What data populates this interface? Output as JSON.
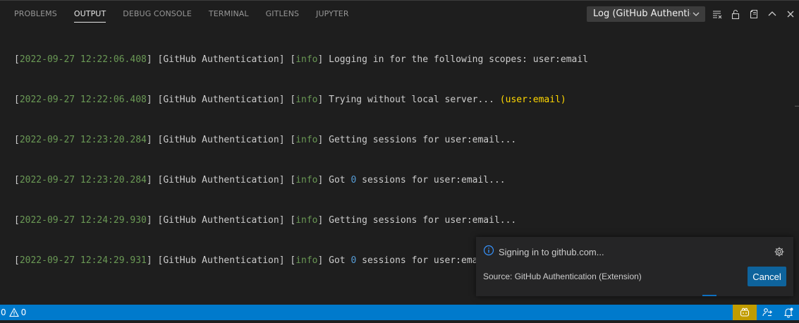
{
  "tabs": [
    {
      "label": "PROBLEMS",
      "active": false
    },
    {
      "label": "OUTPUT",
      "active": true
    },
    {
      "label": "DEBUG CONSOLE",
      "active": false
    },
    {
      "label": "TERMINAL",
      "active": false
    },
    {
      "label": "GITLENS",
      "active": false
    },
    {
      "label": "JUPYTER",
      "active": false
    }
  ],
  "output_channel": {
    "selected": "Log (GitHub Authentication)"
  },
  "actions": [
    "clear-output-icon",
    "lock-scroll-icon",
    "open-in-editor-icon",
    "maximize-panel-icon",
    "close-panel-icon"
  ],
  "log": [
    {
      "ts": "2022-09-27 12:22:06.408",
      "source": "GitHub Authentication",
      "level": "info",
      "pre": "Logging in for the following scopes: user:email",
      "num": "",
      "paren": "",
      "post": ""
    },
    {
      "ts": "2022-09-27 12:22:06.408",
      "source": "GitHub Authentication",
      "level": "info",
      "pre": "Trying without local server... ",
      "num": "",
      "paren": "(user:email)",
      "post": ""
    },
    {
      "ts": "2022-09-27 12:23:20.284",
      "source": "GitHub Authentication",
      "level": "info",
      "pre": "Getting sessions for user:email...",
      "num": "",
      "paren": "",
      "post": ""
    },
    {
      "ts": "2022-09-27 12:23:20.284",
      "source": "GitHub Authentication",
      "level": "info",
      "pre": "Got ",
      "num": "0",
      "paren": "",
      "post": " sessions for user:email..."
    },
    {
      "ts": "2022-09-27 12:24:29.930",
      "source": "GitHub Authentication",
      "level": "info",
      "pre": "Getting sessions for user:email...",
      "num": "",
      "paren": "",
      "post": ""
    },
    {
      "ts": "2022-09-27 12:24:29.931",
      "source": "GitHub Authentication",
      "level": "info",
      "pre": "Got ",
      "num": "0",
      "paren": "",
      "post": " sessions for user:email..."
    }
  ],
  "notification": {
    "message": "Signing in to github.com...",
    "source": "Source: GitHub Authentication (Extension)",
    "cancel_label": "Cancel"
  },
  "status_bar": {
    "errors": "0",
    "warnings": "0",
    "right_icons": [
      "copilot-icon",
      "live-share-icon",
      "notifications-icon"
    ]
  },
  "colors": {
    "accent": "#007acc",
    "timestamp": "#6a9955",
    "number": "#569cd6",
    "paren": "#ffd700",
    "button": "#0e639c",
    "status_highlight": "#c19c00"
  }
}
